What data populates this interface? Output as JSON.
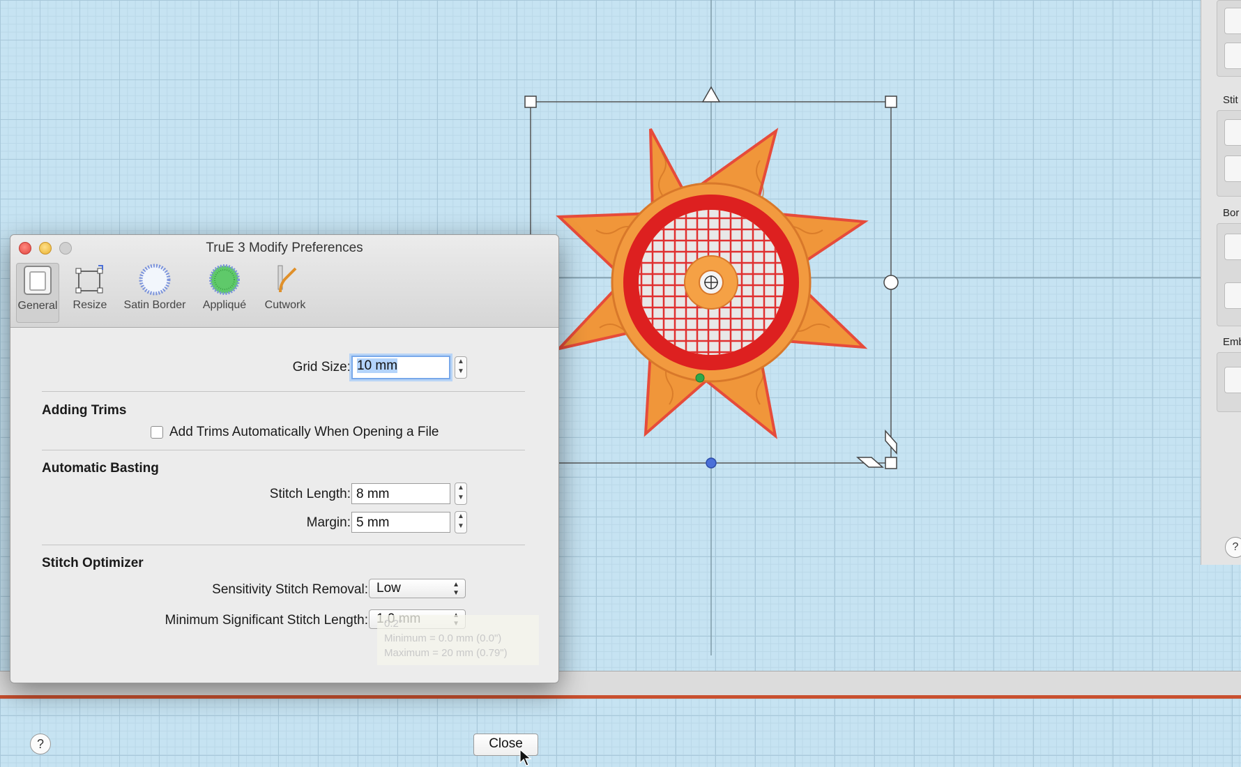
{
  "dialog": {
    "title": "TruE 3 Modify Preferences",
    "toolbar": [
      {
        "label": "General",
        "icon": "general-icon",
        "selected": true
      },
      {
        "label": "Resize",
        "icon": "resize-icon"
      },
      {
        "label": "Satin Border",
        "icon": "satin-border-icon"
      },
      {
        "label": "Appliqué",
        "icon": "applique-icon"
      },
      {
        "label": "Cutwork",
        "icon": "cutwork-icon"
      }
    ],
    "grid_size": {
      "label": "Grid Size:",
      "value": "10 mm"
    },
    "adding_trims": {
      "heading": "Adding Trims",
      "checkbox_label": "Add Trims Automatically When Opening a File",
      "checked": false
    },
    "automatic_basting": {
      "heading": "Automatic Basting",
      "stitch_length_label": "Stitch Length:",
      "stitch_length_value": "8 mm",
      "margin_label": "Margin:",
      "margin_value": "5 mm"
    },
    "stitch_optimizer": {
      "heading": "Stitch Optimizer",
      "sensitivity_label": "Sensitivity Stitch Removal:",
      "sensitivity_value": "Low",
      "min_length_label": "Minimum Significant Stitch Length:",
      "min_length_value": "1.0 mm"
    },
    "tooltip": {
      "line1": "0.2\"",
      "line2": "Minimum = 0.0 mm (0.0\")",
      "line3": "Maximum = 20 mm (0.79\")"
    },
    "help_label": "?",
    "close_label": "Close"
  },
  "right_panel": {
    "labels": [
      "Stit",
      "Bor",
      "Emb"
    ],
    "help_label": "?"
  },
  "colors": {
    "canvas": "#c6e3f2",
    "star_fill": "#f0963a",
    "star_outline": "#e64b3a",
    "ring_red": "#dd2020",
    "handle_blue": "#4a6fd8",
    "handle_green": "#2ea84a"
  }
}
